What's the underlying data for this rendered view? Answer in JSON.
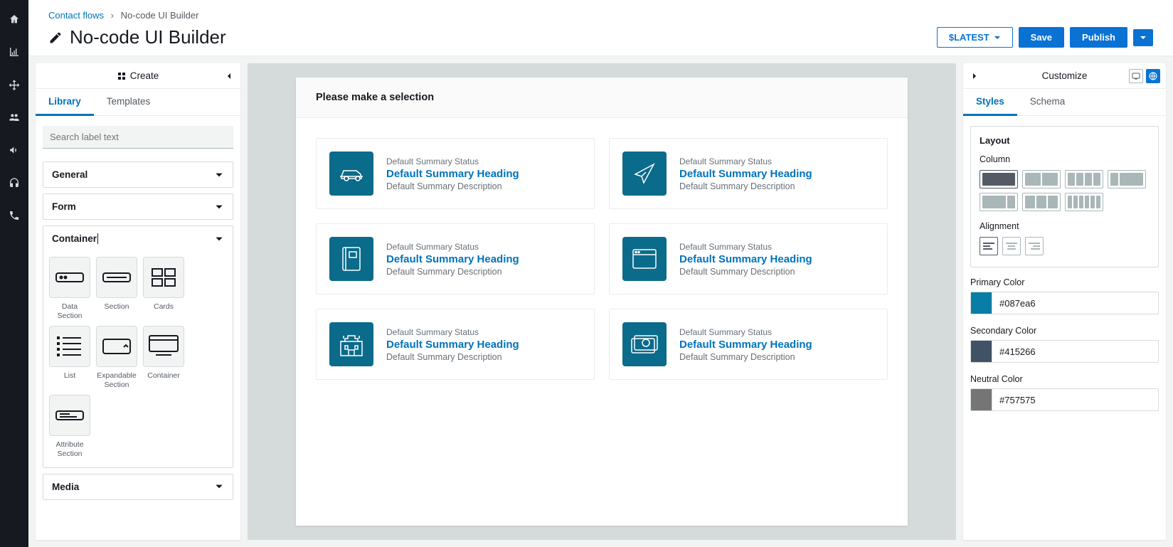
{
  "breadcrumb": {
    "link": "Contact flows",
    "current": "No-code UI Builder"
  },
  "page_title": "No-code UI Builder",
  "header_buttons": {
    "version": "$LATEST",
    "save": "Save",
    "publish": "Publish"
  },
  "left_panel": {
    "title": "Create",
    "tabs": [
      "Library",
      "Templates"
    ],
    "search_placeholder": "Search label text",
    "sections": {
      "general": "General",
      "form": "Form",
      "container": "Container",
      "media": "Media"
    },
    "container_items": [
      {
        "label": "Data Section"
      },
      {
        "label": "Section"
      },
      {
        "label": "Cards"
      },
      {
        "label": "List"
      },
      {
        "label": "Expandable Section"
      },
      {
        "label": "Container"
      },
      {
        "label": "Attribute Section"
      }
    ]
  },
  "canvas": {
    "header": "Please make a selection",
    "cards": [
      {
        "status": "Default Summary Status",
        "heading": "Default Summary Heading",
        "desc": "Default Summary Description",
        "icon": "car"
      },
      {
        "status": "Default Summary Status",
        "heading": "Default Summary Heading",
        "desc": "Default Summary Description",
        "icon": "plane"
      },
      {
        "status": "Default Summary Status",
        "heading": "Default Summary Heading",
        "desc": "Default Summary Description",
        "icon": "book"
      },
      {
        "status": "Default Summary Status",
        "heading": "Default Summary Heading",
        "desc": "Default Summary Description",
        "icon": "window"
      },
      {
        "status": "Default Summary Status",
        "heading": "Default Summary Heading",
        "desc": "Default Summary Description",
        "icon": "castle"
      },
      {
        "status": "Default Summary Status",
        "heading": "Default Summary Heading",
        "desc": "Default Summary Description",
        "icon": "money"
      }
    ]
  },
  "right_panel": {
    "title": "Customize",
    "tabs": [
      "Styles",
      "Schema"
    ],
    "layout_label": "Layout",
    "column_label": "Column",
    "alignment_label": "Alignment",
    "primary_label": "Primary Color",
    "primary_value": "#087ea6",
    "secondary_label": "Secondary Color",
    "secondary_value": "#415266",
    "neutral_label": "Neutral Color",
    "neutral_value": "#757575"
  }
}
